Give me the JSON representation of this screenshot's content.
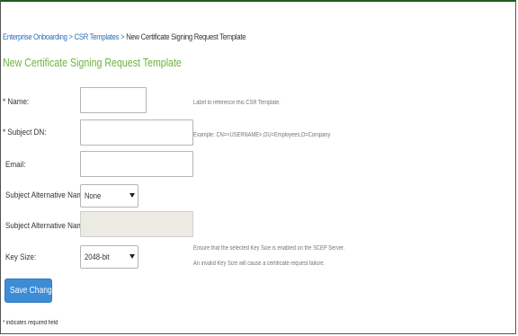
{
  "breadcrumb": {
    "items": [
      {
        "label": "Enterprise Onboarding"
      },
      {
        "label": "CSR Templates"
      }
    ],
    "separator": ">",
    "current": "New Certificate Signing Request Template"
  },
  "page": {
    "title": "New Certificate Signing Request Template"
  },
  "form": {
    "required_marker": "*",
    "fields": {
      "name": {
        "label": "Name:",
        "value": "",
        "help": "Label to reference this CSR Template."
      },
      "subject_dn": {
        "label": "Subject DN:",
        "value": "",
        "help": "Example: CN=<USERNAME>,OU=Employees,O=Company"
      },
      "email": {
        "label": "Email:",
        "value": ""
      },
      "san_type": {
        "label": "Subject Alternative Name Type:",
        "selected": "None"
      },
      "san_value": {
        "label": "Subject Alternative Name Value:",
        "value": ""
      },
      "key_size": {
        "label": "Key Size:",
        "selected": "2048-bit",
        "help_line1": "Ensure that the selected Key Size is enabled on the SCEP Server.",
        "help_line2": "An invalid Key Size will cause a certificate request failure."
      }
    },
    "save_label": "Save Changes",
    "footnote": "* indicates required field"
  },
  "colors": {
    "title_green": "#6db33f",
    "link_blue": "#2a6ebb",
    "button_blue": "#3c8dd6",
    "frame_top": "#1b5e20"
  }
}
